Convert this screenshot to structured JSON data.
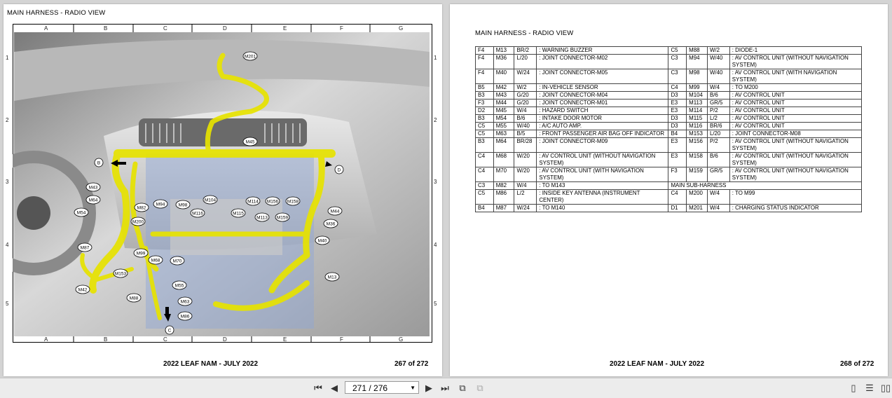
{
  "left_page": {
    "title": "MAIN HARNESS - RADIO VIEW",
    "footer_center": "2022 LEAF NAM - JULY 2022",
    "footer_right": "267 of 272",
    "columns": [
      "A",
      "B",
      "C",
      "D",
      "E",
      "F",
      "G"
    ],
    "rows": [
      "1",
      "2",
      "3",
      "4",
      "5"
    ],
    "callouts": [
      "M201",
      "M45",
      "B",
      "D",
      "M43",
      "M64",
      "M54",
      "M94",
      "M98",
      "M104",
      "M114",
      "M156",
      "M158",
      "M82",
      "M116",
      "M115",
      "M113",
      "M159",
      "M44",
      "M36",
      "M200",
      "M40",
      "M87",
      "M99",
      "M68",
      "M70",
      "M153",
      "M13",
      "M42",
      "M55",
      "M88",
      "M63",
      "M86",
      "C"
    ]
  },
  "right_page": {
    "title": "MAIN HARNESS - RADIO VIEW",
    "footer_center": "2022 LEAF NAM - JULY 2022",
    "footer_right": "268 of 272",
    "rows": [
      {
        "l": [
          "F4",
          "M13",
          "BR/2",
          ": WARNING BUZZER"
        ],
        "r": [
          "C5",
          "M88",
          "W/2",
          ": DIODE-1"
        ]
      },
      {
        "l": [
          "F4",
          "M36",
          "L/20",
          ": JOINT CONNECTOR-M02"
        ],
        "r": [
          "C3",
          "M94",
          "W/40",
          ": AV CONTROL UNIT (WITHOUT NAVIGATION SYSTEM)"
        ]
      },
      {
        "l": [
          "F4",
          "M40",
          "W/24",
          ": JOINT CONNECTOR-M05"
        ],
        "r": [
          "C3",
          "M98",
          "W/40",
          ": AV CONTROL UNIT (WITH NAVIGATION SYSTEM)"
        ]
      },
      {
        "l": [
          "B5",
          "M42",
          "W/2",
          ": IN-VEHICLE SENSOR"
        ],
        "r": [
          "C4",
          "M99",
          "W/4",
          ": TO M200"
        ]
      },
      {
        "l": [
          "B3",
          "M43",
          "G/20",
          ": JOINT CONNECTOR-M04"
        ],
        "r": [
          "D3",
          "M104",
          "B/6",
          ": AV CONTROL UNIT"
        ]
      },
      {
        "l": [
          "F3",
          "M44",
          "G/20",
          ": JOINT CONNECTOR-M01"
        ],
        "r": [
          "E3",
          "M113",
          "GR/5",
          ": AV CONTROL UNIT"
        ]
      },
      {
        "l": [
          "D2",
          "M45",
          "W/4",
          ": HAZARD SWITCH"
        ],
        "r": [
          "E3",
          "M114",
          "P/2",
          ": AV CONTROL UNIT"
        ]
      },
      {
        "l": [
          "B3",
          "M54",
          "B/6",
          ": INTAKE DOOR MOTOR"
        ],
        "r": [
          "D3",
          "M115",
          "L/2",
          ": AV CONTROL UNIT"
        ]
      },
      {
        "l": [
          "C5",
          "M55",
          "W/40",
          ": A/C AUTO AMP."
        ],
        "r": [
          "D3",
          "M116",
          "BR/6",
          ": AV CONTROL UNIT"
        ]
      },
      {
        "l": [
          "C5",
          "M63",
          "B/5",
          ": FRONT PASSENGER AIR BAG OFF INDICATOR"
        ],
        "r": [
          "B4",
          "M153",
          "L/20",
          ": JOINT CONNECTOR-M08"
        ]
      },
      {
        "l": [
          "B3",
          "M64",
          "BR/28",
          ": JOINT CONNECTOR-M09"
        ],
        "r": [
          "E3",
          "M156",
          "P/2",
          ": AV CONTROL UNIT (WITHOUT NAVIGATION SYSTEM)"
        ]
      },
      {
        "l": [
          "C4",
          "M68",
          "W/20",
          ": AV CONTROL UNIT (WITHOUT NAVIGATION SYSTEM)"
        ],
        "r": [
          "E3",
          "M158",
          "B/6",
          ": AV CONTROL UNIT (WITHOUT NAVIGATION SYSTEM)"
        ]
      },
      {
        "l": [
          "C4",
          "M70",
          "W/20",
          ": AV CONTROL UNIT (WITH NAVIGATION SYSTEM)"
        ],
        "r": [
          "F3",
          "M159",
          "GR/5",
          ": AV CONTROL UNIT (WITHOUT NAVIGATION SYSTEM)"
        ]
      },
      {
        "l": [
          "C3",
          "M82",
          "W/4",
          ": TO M143"
        ],
        "section": "MAIN SUB-HARNESS"
      },
      {
        "l": [
          "C5",
          "M86",
          "L/2",
          ": INSIDE KEY ANTENNA (INSTRUMENT CENTER)"
        ],
        "r": [
          "C4",
          "M200",
          "W/4",
          ": TO M99"
        ]
      },
      {
        "l": [
          "B4",
          "M87",
          "W/24",
          ": TO M140"
        ],
        "r": [
          "D1",
          "M201",
          "W/4",
          ": CHARGING STATUS INDICATOR"
        ]
      }
    ]
  },
  "toolbar": {
    "page_indicator": "271 / 276",
    "icons": [
      "first-page-icon",
      "prev-page-icon",
      "next-page-icon",
      "last-page-icon",
      "copy-icon",
      "paste-icon",
      "single-page-icon",
      "continuous-icon",
      "two-page-icon"
    ]
  }
}
